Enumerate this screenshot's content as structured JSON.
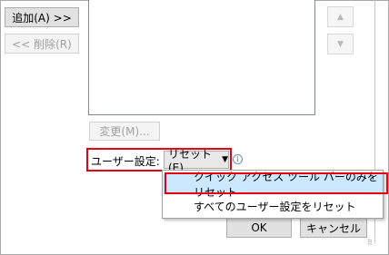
{
  "buttons": {
    "add": "追加(A) >>",
    "remove": "<< 削除(R)",
    "modify": "変更(M)...",
    "ok": "OK",
    "cancel": "キャンセル"
  },
  "customization": {
    "label": "ユーザー設定:",
    "dropdown": "リセット(E)"
  },
  "menu": {
    "items": [
      "クイック アクセス ツール バーのみをリセット",
      "すべてのユーザー設定をリセット"
    ]
  },
  "colors": {
    "highlight_border": "#e60012",
    "menu_hover": "#cce8ff"
  }
}
